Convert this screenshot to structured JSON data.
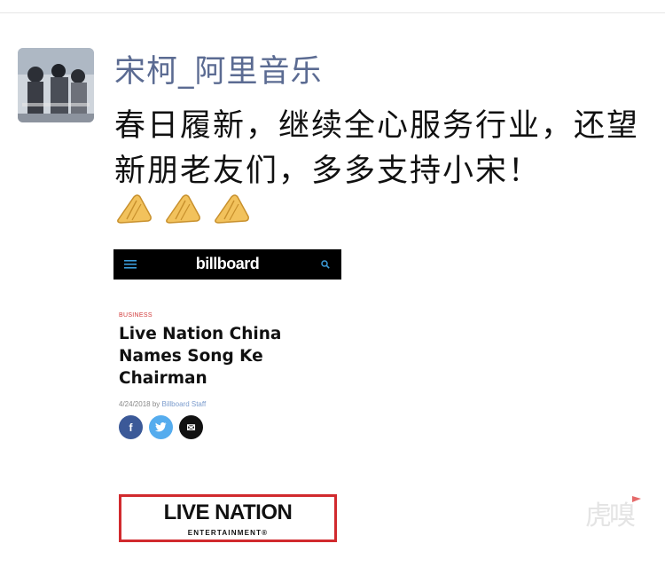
{
  "post": {
    "username": "宋柯_阿里音乐",
    "text": "春日履新，继续全心服务行业，还望新朋老友们，多多支持小宋！",
    "emojis": [
      "folded-hands-icon",
      "folded-hands-icon",
      "folded-hands-icon"
    ]
  },
  "card": {
    "header_logo": "billboard",
    "category": "BUSINESS",
    "headline": "Live Nation China Names Song Ke Chairman",
    "date": "4/24/2018",
    "by": "by",
    "author": "Billboard Staff",
    "share_facebook": "f",
    "share_twitter": "t",
    "share_email": "✉",
    "live_nation_logo": "LIVE NATION",
    "live_nation_sub": "ENTERTAINMENT®"
  },
  "watermark": "虎嗅",
  "colors": {
    "username": "#5b6b92",
    "billboard_header": "#000000",
    "category_red": "#d23a3a",
    "facebook": "#3b5998",
    "twitter": "#55acee",
    "live_nation_red": "#d12a2e"
  }
}
